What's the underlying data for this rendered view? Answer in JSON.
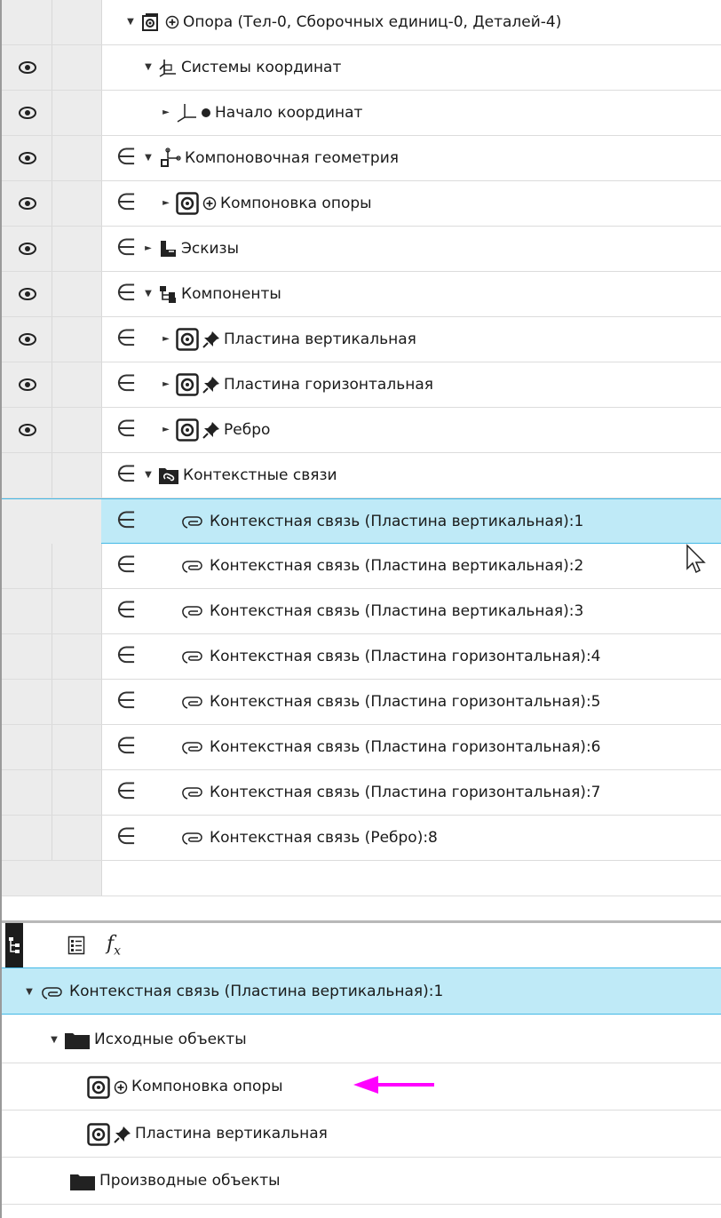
{
  "tree": {
    "root": {
      "label": "Опора (Тел-0, Сборочных единиц-0, Деталей-4)",
      "icon": "assembly-icon"
    },
    "coord_systems": {
      "label": "Системы координат",
      "icon": "coordinate-system-icon"
    },
    "origin": {
      "label": "Начало координат",
      "icon": "origin-axes-icon"
    },
    "layout_geometry": {
      "label": "Компоновочная геометрия",
      "icon": "layout-geometry-icon"
    },
    "layout_support": {
      "label": "Компоновка опоры",
      "icon": "component-icon"
    },
    "sketches": {
      "label": "Эскизы",
      "icon": "sketch-icon"
    },
    "components": {
      "label": "Компоненты",
      "icon": "components-icon"
    },
    "plate_vertical": {
      "label": "Пластина вертикальная",
      "icon": "component-icon"
    },
    "plate_horizontal": {
      "label": "Пластина горизонтальная",
      "icon": "component-icon"
    },
    "rib": {
      "label": "Ребро",
      "icon": "component-icon"
    },
    "context_links": {
      "label": "Контекстные связи",
      "icon": "context-links-folder-icon"
    },
    "links": [
      {
        "label": "Контекстная связь (Пластина вертикальная):1"
      },
      {
        "label": "Контекстная связь (Пластина вертикальная):2"
      },
      {
        "label": "Контекстная связь (Пластина вертикальная):3"
      },
      {
        "label": "Контекстная связь (Пластина горизонтальная):4"
      },
      {
        "label": "Контекстная связь (Пластина горизонтальная):5"
      },
      {
        "label": "Контекстная связь (Пластина горизонтальная):6"
      },
      {
        "label": "Контекстная связь (Пластина горизонтальная):7"
      },
      {
        "label": "Контекстная связь (Ребро):8"
      }
    ],
    "gutter_glyph": "∈"
  },
  "tabs": {
    "fx_label": "f",
    "fx_sub": "x"
  },
  "details": {
    "selected_link": "Контекстная связь (Пластина вертикальная):1",
    "source_objects": "Исходные объекты",
    "source_layout": "Компоновка опоры",
    "source_plate": "Пластина вертикальная",
    "derived_objects": "Производные объекты"
  },
  "colors": {
    "selection": "#bfeaf7",
    "selection_border": "#43b8e6",
    "annotation_arrow": "#ff00ff"
  }
}
